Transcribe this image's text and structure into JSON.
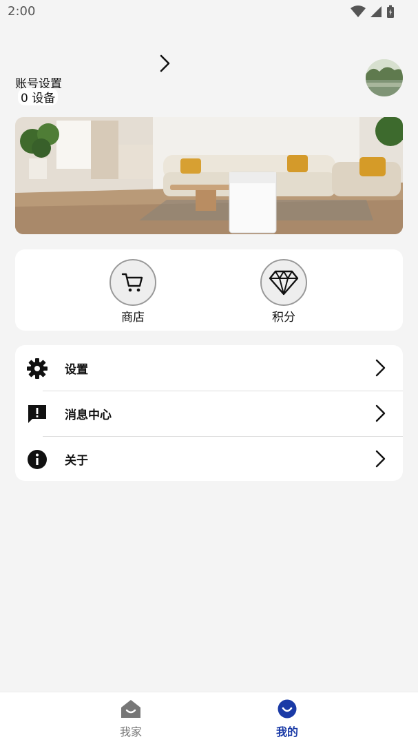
{
  "status_bar": {
    "time": "2:00"
  },
  "profile": {
    "account_label": "账号设置",
    "device_count": "0 设备"
  },
  "quick_actions": [
    {
      "label": "商店",
      "icon": "cart-icon"
    },
    {
      "label": "积分",
      "icon": "diamond-icon"
    }
  ],
  "menu": [
    {
      "label": "设置",
      "icon": "gear-icon"
    },
    {
      "label": "消息中心",
      "icon": "message-alert-icon"
    },
    {
      "label": "关于",
      "icon": "info-icon"
    }
  ],
  "bottom_nav": [
    {
      "label": "我家",
      "icon": "home-icon",
      "active": false
    },
    {
      "label": "我的",
      "icon": "smile-icon",
      "active": true
    }
  ],
  "colors": {
    "accent": "#1a3aa6",
    "inactive": "#777777",
    "background": "#f4f4f4"
  }
}
